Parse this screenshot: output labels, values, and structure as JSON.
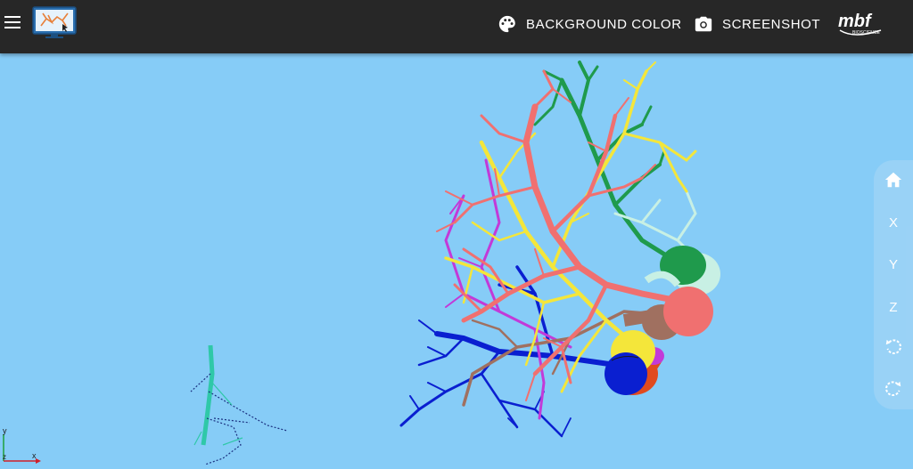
{
  "toolbar": {
    "background_color_label": "BACKGROUND COLOR",
    "screenshot_label": "SCREENSHOT",
    "brand_text": "mbf",
    "brand_subtext": "BIOSCIENCE"
  },
  "view_controls": {
    "x_label": "X",
    "y_label": "Y",
    "z_label": "Z"
  },
  "axes_indicator": {
    "y_label": "y",
    "z_label": "z",
    "x_label": "x"
  },
  "colors": {
    "toolbar_bg": "#272727",
    "canvas_bg": "#86ccf7",
    "neuron_salmon": "#f07070",
    "neuron_yellow": "#f4e63a",
    "neuron_green": "#1f9a4c",
    "neuron_blue": "#0a1fd0",
    "neuron_magenta": "#c23ad8",
    "neuron_brown": "#a07060",
    "neuron_teal": "#30c8a0"
  },
  "icons": {
    "menu": "hamburger-icon",
    "app_logo": "neuron-monitor-logo",
    "background_color": "palette-icon",
    "screenshot": "camera-icon",
    "home": "home-icon",
    "rotate_ccw": "rotate-left-icon",
    "rotate_cw": "rotate-right-icon"
  }
}
